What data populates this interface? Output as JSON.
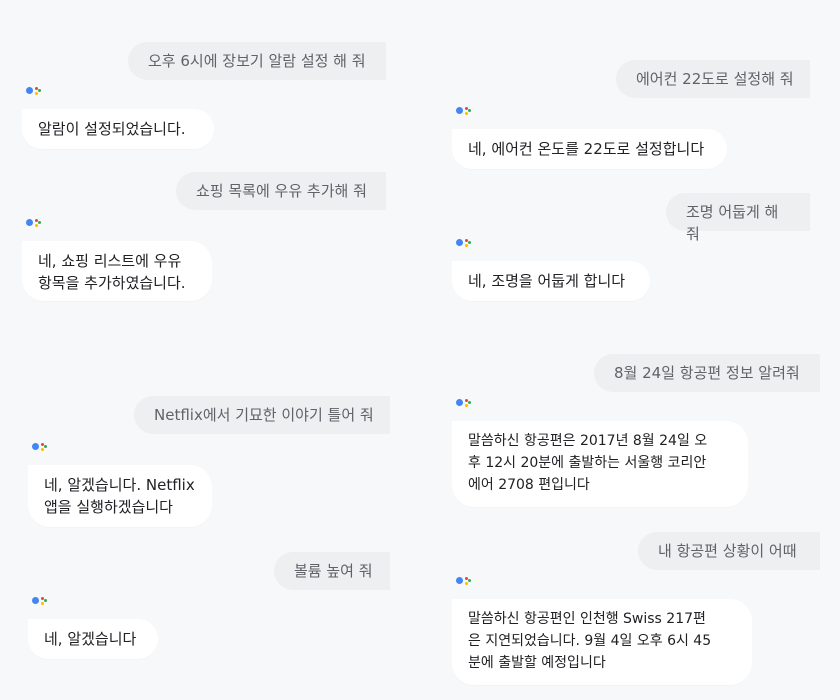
{
  "colors": {
    "background": "#f7f8fa",
    "user_bubble": "#eeeff1",
    "user_text": "#5f6368",
    "assistant_bubble": "#ffffff",
    "assistant_text": "#202124",
    "logo_blue": "#4285f4",
    "logo_red": "#ea4335",
    "logo_yellow": "#fbbc05",
    "logo_green": "#34a853"
  },
  "left_column": [
    {
      "user": "오후 6시에 장보기 알람 설정 해 줘",
      "assistant": "알람이 설정되었습니다."
    },
    {
      "user": "쇼핑 목록에 우유 추가해 줘",
      "assistant": "네, 쇼핑 리스트에 우유\n항목을 추가하였습니다."
    },
    {
      "user": "Netflix에서 기묘한 이야기 틀어 줘",
      "assistant": "네, 알겠습니다. Netflix\n앱을 실행하겠습니다"
    },
    {
      "user": "볼륨 높여 줘",
      "assistant": "네, 알겠습니다"
    }
  ],
  "right_column": [
    {
      "user": "에어컨 22도로 설정해 줘",
      "assistant": "네, 에어컨 온도를 22도로 설정합니다"
    },
    {
      "user": "조명 어둡게 해 줘",
      "assistant": "네, 조명을 어둡게 합니다"
    },
    {
      "user": "8월 24일 항공편 정보 알려줘",
      "assistant": "말씀하신 항공편은 2017년 8월 24일 오\n후 12시 20분에 출발하는 서울행 코리안\n에어 2708 편입니다"
    },
    {
      "user": "내 항공편 상황이 어때",
      "assistant": "말씀하신 항공편인 인천행 Swiss 217편\n은 지연되었습니다. 9월 4일 오후 6시 45\n분에 출발할 예정입니다"
    }
  ],
  "icons": {
    "assistant_logo": "google-assistant-logo-icon"
  }
}
